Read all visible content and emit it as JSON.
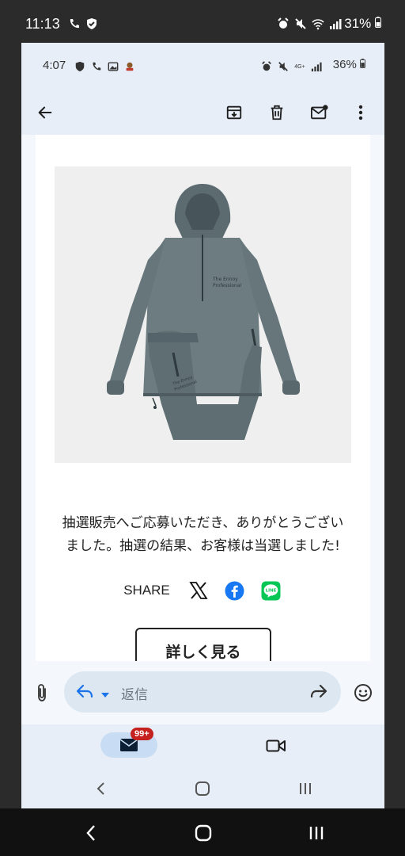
{
  "outer_status": {
    "time": "11:13",
    "battery": "31%"
  },
  "inner_status": {
    "time": "4:07",
    "battery": "36%",
    "network": "4G+"
  },
  "toolbar": {
    "back": "back-icon",
    "archive": "archive-icon",
    "delete": "trash-icon",
    "mark_unread": "mark-unread-icon",
    "more": "more-icon"
  },
  "email": {
    "message_line1": "抽選販売へご応募いただき、ありがとうござい",
    "message_line2": "ました。抽選の結果、お客様は当選しました!",
    "share_label": "SHARE",
    "share_icons": [
      "x-icon",
      "facebook-icon",
      "line-icon"
    ],
    "details_button": "詳しく見る",
    "line_logo_text": "LINE",
    "product_print_line1": "The Ennoy",
    "product_print_line2": "Professional"
  },
  "reply_bar": {
    "placeholder": "返信"
  },
  "bottom_nav": {
    "badge": "99+"
  },
  "colors": {
    "accent": "#1a73e8",
    "badge": "#c5221f",
    "facebook": "#1877f2",
    "line": "#06c755"
  }
}
